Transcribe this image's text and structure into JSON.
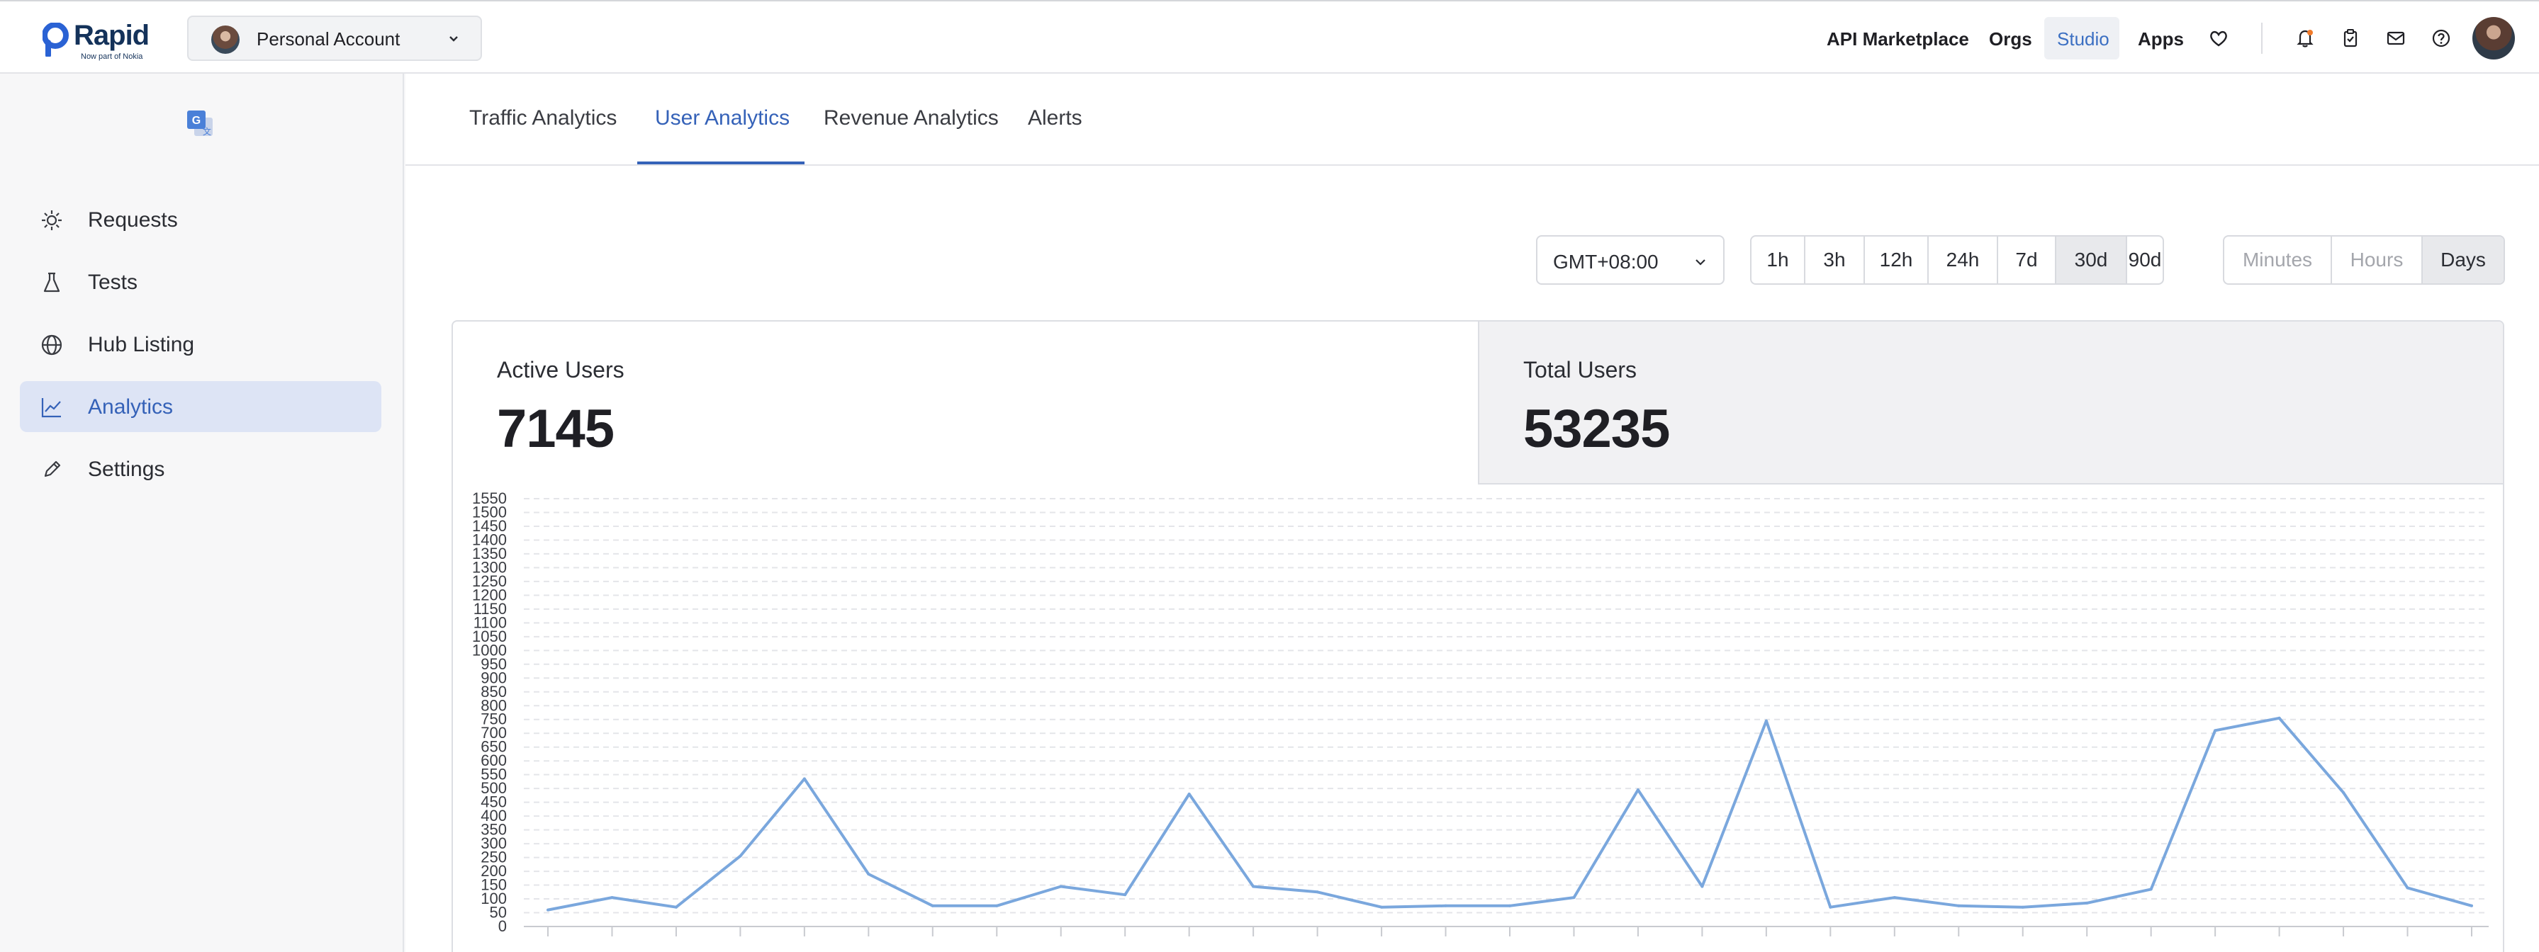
{
  "brand": {
    "name": "Rapid",
    "tagline": "Now part of Nokia",
    "color": "#14325a"
  },
  "account": {
    "label": "Personal Account"
  },
  "topnav": {
    "api_marketplace": "API Marketplace",
    "orgs": "Orgs",
    "studio": "Studio",
    "apps": "Apps",
    "icons": [
      "heart-icon",
      "bell-icon",
      "clipboard-icon",
      "mail-icon",
      "help-icon"
    ]
  },
  "sidebar": {
    "items": [
      {
        "label": "Requests",
        "icon": "requests-icon"
      },
      {
        "label": "Tests",
        "icon": "flask-icon"
      },
      {
        "label": "Hub Listing",
        "icon": "globe-icon"
      },
      {
        "label": "Analytics",
        "icon": "chart-line-icon",
        "active": true
      },
      {
        "label": "Settings",
        "icon": "pencil-icon"
      }
    ]
  },
  "tabs": [
    {
      "label": "Traffic Analytics"
    },
    {
      "label": "User Analytics",
      "active": true
    },
    {
      "label": "Revenue Analytics"
    },
    {
      "label": "Alerts"
    }
  ],
  "filters": {
    "timezone": "GMT+08:00",
    "ranges": [
      "1h",
      "3h",
      "12h",
      "24h",
      "7d",
      "30d",
      "90d"
    ],
    "range_selected": "30d",
    "granularity": [
      "Minutes",
      "Hours",
      "Days"
    ],
    "granularity_selected": "Days",
    "granularity_disabled": [
      "Minutes",
      "Hours"
    ]
  },
  "metrics": {
    "active_users": {
      "label": "Active Users",
      "value": "7145"
    },
    "total_users": {
      "label": "Total Users",
      "value": "53235"
    }
  },
  "colors": {
    "accent": "#3562b8",
    "line": "#7aa7dd",
    "active_nav_bg": "#dde4f5"
  },
  "chart_data": {
    "type": "line",
    "title": "",
    "xlabel": "",
    "ylabel": "",
    "ylim": [
      0,
      1550
    ],
    "yticks": [
      0,
      50,
      100,
      150,
      200,
      250,
      300,
      350,
      400,
      450,
      500,
      550,
      600,
      650,
      700,
      750,
      800,
      850,
      900,
      950,
      1000,
      1050,
      1100,
      1150,
      1200,
      1250,
      1300,
      1350,
      1400,
      1450,
      1500,
      1550
    ],
    "grid": true,
    "series": [
      {
        "values": [
          60,
          105,
          70,
          255,
          535,
          190,
          75,
          75,
          145,
          115,
          480,
          145,
          125,
          70,
          75,
          75,
          105,
          495,
          145,
          745,
          70,
          105,
          75,
          70,
          85,
          135,
          710,
          755,
          485,
          140,
          75
        ]
      }
    ]
  }
}
